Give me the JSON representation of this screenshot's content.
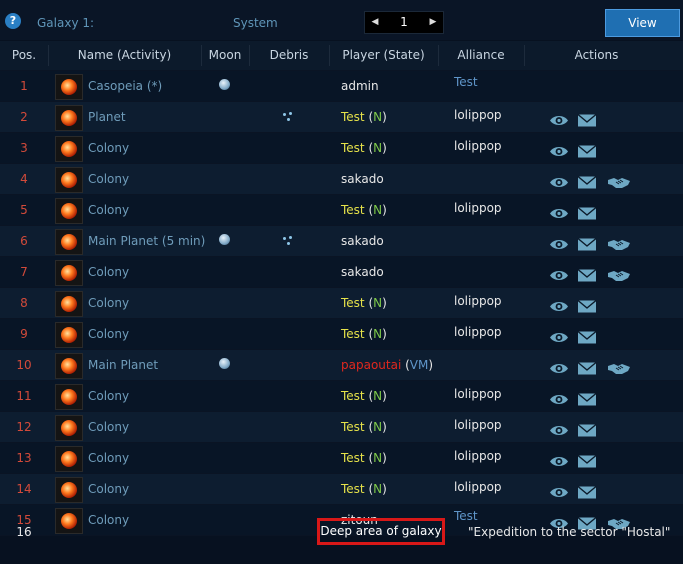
{
  "toolbar": {
    "help_label": "?",
    "galaxy_label": "Galaxy 1:",
    "system_label": "System",
    "system_number": "1",
    "prev_label": "◀",
    "next_label": "▶",
    "view_label": "View"
  },
  "table": {
    "headers": [
      "Pos.",
      "Name (Activity)",
      "Moon",
      "Debris",
      "Player (State)",
      "Alliance",
      "Actions"
    ],
    "rows": [
      {
        "pos": "1",
        "name": "Casopeia (*)",
        "moon": true,
        "debris": false,
        "player": "admin",
        "player_color": "white",
        "state": "",
        "state_color": "",
        "alliance": "Test",
        "alliance_link": true,
        "eye": false,
        "mail": false,
        "buddy": false
      },
      {
        "pos": "2",
        "name": "Planet",
        "moon": false,
        "debris": true,
        "player": "Test",
        "player_color": "yellow",
        "state": "N",
        "state_color": "green",
        "alliance": "lolippop",
        "alliance_link": false,
        "eye": true,
        "mail": true,
        "buddy": false
      },
      {
        "pos": "3",
        "name": "Colony",
        "moon": false,
        "debris": false,
        "player": "Test",
        "player_color": "yellow",
        "state": "N",
        "state_color": "green",
        "alliance": "lolippop",
        "alliance_link": false,
        "eye": true,
        "mail": true,
        "buddy": false
      },
      {
        "pos": "4",
        "name": "Colony",
        "moon": false,
        "debris": false,
        "player": "sakado",
        "player_color": "white",
        "state": "",
        "state_color": "",
        "alliance": "",
        "alliance_link": false,
        "eye": true,
        "mail": true,
        "buddy": true
      },
      {
        "pos": "5",
        "name": "Colony",
        "moon": false,
        "debris": false,
        "player": "Test",
        "player_color": "yellow",
        "state": "N",
        "state_color": "green",
        "alliance": "lolippop",
        "alliance_link": false,
        "eye": true,
        "mail": true,
        "buddy": false
      },
      {
        "pos": "6",
        "name": "Main Planet (5 min)",
        "moon": true,
        "debris": true,
        "player": "sakado",
        "player_color": "white",
        "state": "",
        "state_color": "",
        "alliance": "",
        "alliance_link": false,
        "eye": true,
        "mail": true,
        "buddy": true
      },
      {
        "pos": "7",
        "name": "Colony",
        "moon": false,
        "debris": false,
        "player": "sakado",
        "player_color": "white",
        "state": "",
        "state_color": "",
        "alliance": "",
        "alliance_link": false,
        "eye": true,
        "mail": true,
        "buddy": true
      },
      {
        "pos": "8",
        "name": "Colony",
        "moon": false,
        "debris": false,
        "player": "Test",
        "player_color": "yellow",
        "state": "N",
        "state_color": "green",
        "alliance": "lolippop",
        "alliance_link": false,
        "eye": true,
        "mail": true,
        "buddy": false
      },
      {
        "pos": "9",
        "name": "Colony",
        "moon": false,
        "debris": false,
        "player": "Test",
        "player_color": "yellow",
        "state": "N",
        "state_color": "green",
        "alliance": "lolippop",
        "alliance_link": false,
        "eye": true,
        "mail": true,
        "buddy": false
      },
      {
        "pos": "10",
        "name": "Main Planet",
        "moon": true,
        "debris": false,
        "player": "papaoutai",
        "player_color": "red",
        "state": "VM",
        "state_color": "blue",
        "alliance": "",
        "alliance_link": false,
        "eye": true,
        "mail": true,
        "buddy": true
      },
      {
        "pos": "11",
        "name": "Colony",
        "moon": false,
        "debris": false,
        "player": "Test",
        "player_color": "yellow",
        "state": "N",
        "state_color": "green",
        "alliance": "lolippop",
        "alliance_link": false,
        "eye": true,
        "mail": true,
        "buddy": false
      },
      {
        "pos": "12",
        "name": "Colony",
        "moon": false,
        "debris": false,
        "player": "Test",
        "player_color": "yellow",
        "state": "N",
        "state_color": "green",
        "alliance": "lolippop",
        "alliance_link": false,
        "eye": true,
        "mail": true,
        "buddy": false
      },
      {
        "pos": "13",
        "name": "Colony",
        "moon": false,
        "debris": false,
        "player": "Test",
        "player_color": "yellow",
        "state": "N",
        "state_color": "green",
        "alliance": "lolippop",
        "alliance_link": false,
        "eye": true,
        "mail": true,
        "buddy": false
      },
      {
        "pos": "14",
        "name": "Colony",
        "moon": false,
        "debris": false,
        "player": "Test",
        "player_color": "yellow",
        "state": "N",
        "state_color": "green",
        "alliance": "lolippop",
        "alliance_link": false,
        "eye": true,
        "mail": true,
        "buddy": false
      },
      {
        "pos": "15",
        "name": "Colony",
        "moon": false,
        "debris": false,
        "player": "zitoun",
        "player_color": "white",
        "state": "",
        "state_color": "",
        "alliance": "Test",
        "alliance_link": true,
        "eye": true,
        "mail": true,
        "buddy": true
      }
    ],
    "last_row": {
      "pos": "16",
      "deep_area_label": "Deep area of galaxy",
      "expedition_text": "\"Expedition to the sector \"Hostal\""
    }
  },
  "icons": {
    "planet": "planet-icon",
    "moon": "moon-icon",
    "debris": "debris-icon",
    "eye": "eye-icon",
    "mail": "mail-icon",
    "buddy": "handshake-icon"
  },
  "colors": {
    "background": "#071120",
    "view_button": "#1f6fb2",
    "position_number": "#d24a3a",
    "player_yellow": "#e6e24a",
    "state_green": "#7ec94a",
    "player_red": "#e0281e",
    "state_blue": "#5f95c8",
    "highlight_box": "#d81818"
  }
}
